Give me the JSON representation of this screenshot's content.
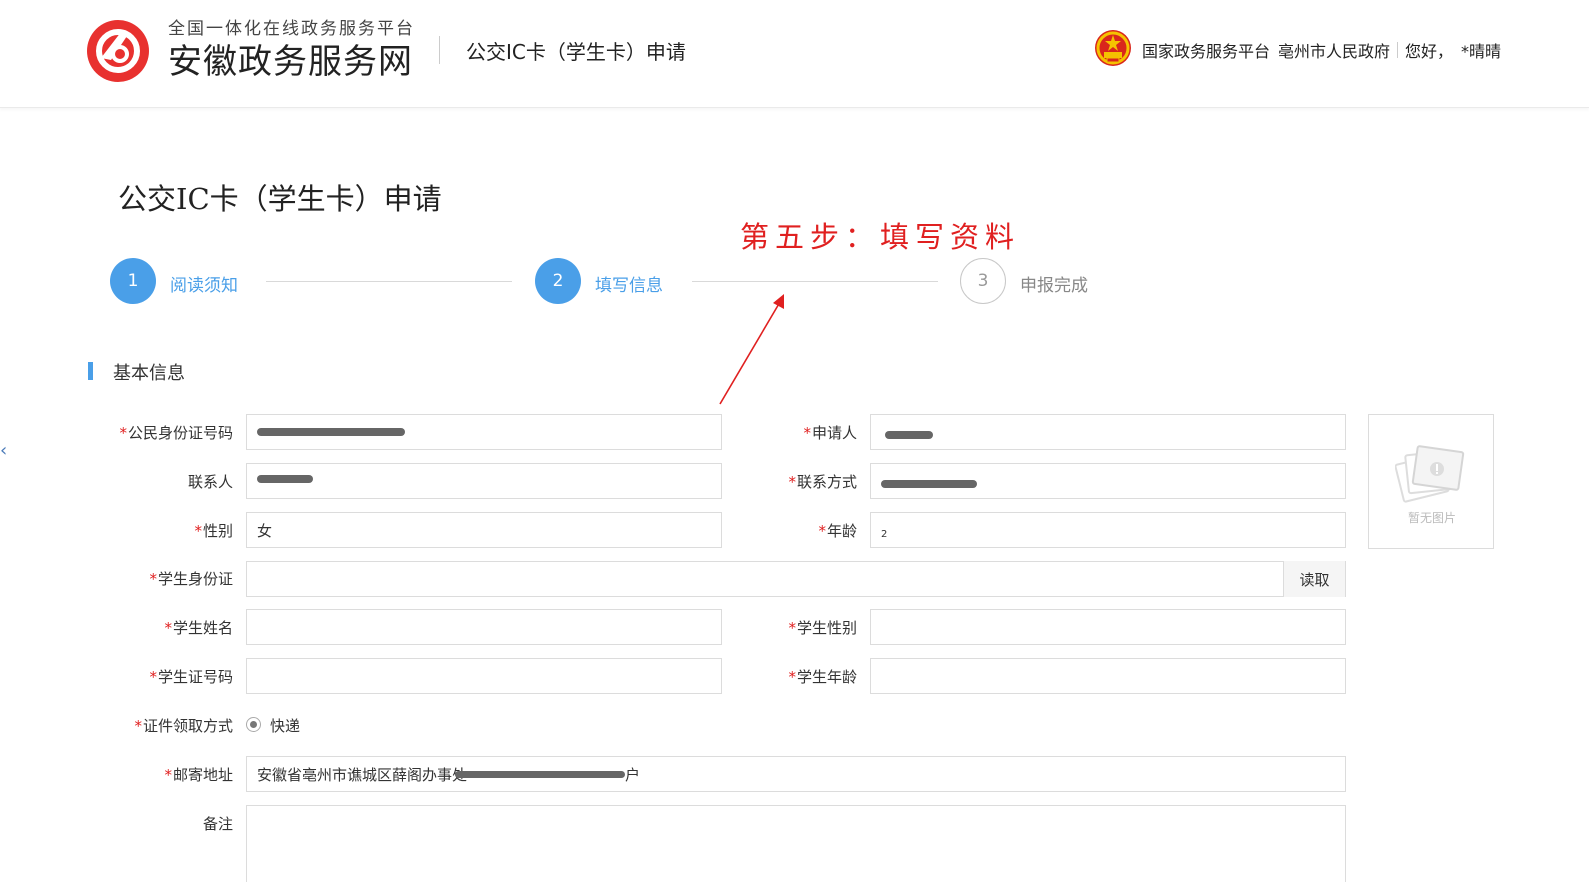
{
  "header": {
    "logo_subtitle": "全国一体化在线政务服务平台",
    "logo_title": "安徽政务服务网",
    "page_name": "公交IC卡（学生卡）申请",
    "links": {
      "national_platform": "国家政务服务平台",
      "city_gov": "亳州市人民政府",
      "greeting": "您好，",
      "user": "*晴晴"
    }
  },
  "page_title": "公交IC卡（学生卡）申请",
  "annotation": "第五步：填写资料",
  "steps": [
    {
      "number": "1",
      "label": "阅读须知",
      "state": "done"
    },
    {
      "number": "2",
      "label": "填写信息",
      "state": "current"
    },
    {
      "number": "3",
      "label": "申报完成",
      "state": "pending"
    }
  ],
  "section_title": "基本信息",
  "form": {
    "id_number": {
      "label": "公民身份证号码",
      "required": true,
      "value": ""
    },
    "applicant": {
      "label": "申请人",
      "required": true,
      "value": ""
    },
    "contact_person": {
      "label": "联系人",
      "required": false,
      "value": ""
    },
    "contact_phone": {
      "label": "联系方式",
      "required": true,
      "value": ""
    },
    "gender": {
      "label": "性别",
      "required": true,
      "value": "女"
    },
    "age": {
      "label": "年龄",
      "required": true,
      "value": "2"
    },
    "student_id_card": {
      "label": "学生身份证",
      "required": true,
      "value": "",
      "button": "读取"
    },
    "student_name": {
      "label": "学生姓名",
      "required": true,
      "value": ""
    },
    "student_gender": {
      "label": "学生性别",
      "required": true,
      "value": ""
    },
    "student_cert_no": {
      "label": "学生证号码",
      "required": true,
      "value": ""
    },
    "student_age": {
      "label": "学生年龄",
      "required": true,
      "value": ""
    },
    "pickup_method": {
      "label": "证件领取方式",
      "required": true,
      "option": "快递"
    },
    "mail_address": {
      "label": "邮寄地址",
      "required": true,
      "value": "安徽省亳州市谯城区薛阁办事处",
      "value_suffix": "户"
    },
    "remarks": {
      "label": "备注",
      "required": false,
      "value": ""
    }
  },
  "photo": {
    "placeholder": "暂无图片"
  },
  "colors": {
    "accent": "#4a9fe8",
    "required": "#e02020",
    "brand_red": "#e8312f"
  }
}
